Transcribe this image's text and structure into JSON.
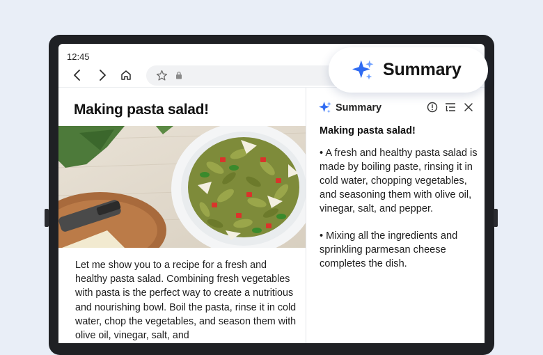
{
  "status_bar": {
    "time": "12:45"
  },
  "toolbar": {
    "back_icon": "chevron-left-icon",
    "forward_icon": "chevron-right-icon",
    "home_icon": "home-icon",
    "bookmark_icon": "star-icon",
    "lock_icon": "lock-icon"
  },
  "article": {
    "title": "Making pasta salad!",
    "body": "Let me show you to a recipe for a fresh and healthy pasta salad. Combining fresh vegetables with pasta is the perfect way to create a nutritious and nourishing bowl. Boil the pasta, rinse it in cold water, chop the vegetables, and season them with olive oil, vinegar, salt, and"
  },
  "summary_panel": {
    "header_title": "Summary",
    "article_title": "Making pasta salad!",
    "bullets": [
      "• A fresh and healthy pasta salad is made by boiling paste, rinsing it in cold water, chopping vegetables, and seasoning them with olive oil, vinegar, salt, and pepper.",
      "• Mixing all the ingredients and sprinkling parmesan cheese completes the dish."
    ],
    "tools": [
      "info-icon",
      "list-settings-icon",
      "close-icon"
    ]
  },
  "summary_pill": {
    "label": "Summary",
    "icon": "sparkle-icon"
  },
  "colors": {
    "sparkle_blue": "#2f6bf2",
    "sparkle_light": "#6fa0ff",
    "background": "#e9eef7",
    "device": "#1f2024"
  }
}
